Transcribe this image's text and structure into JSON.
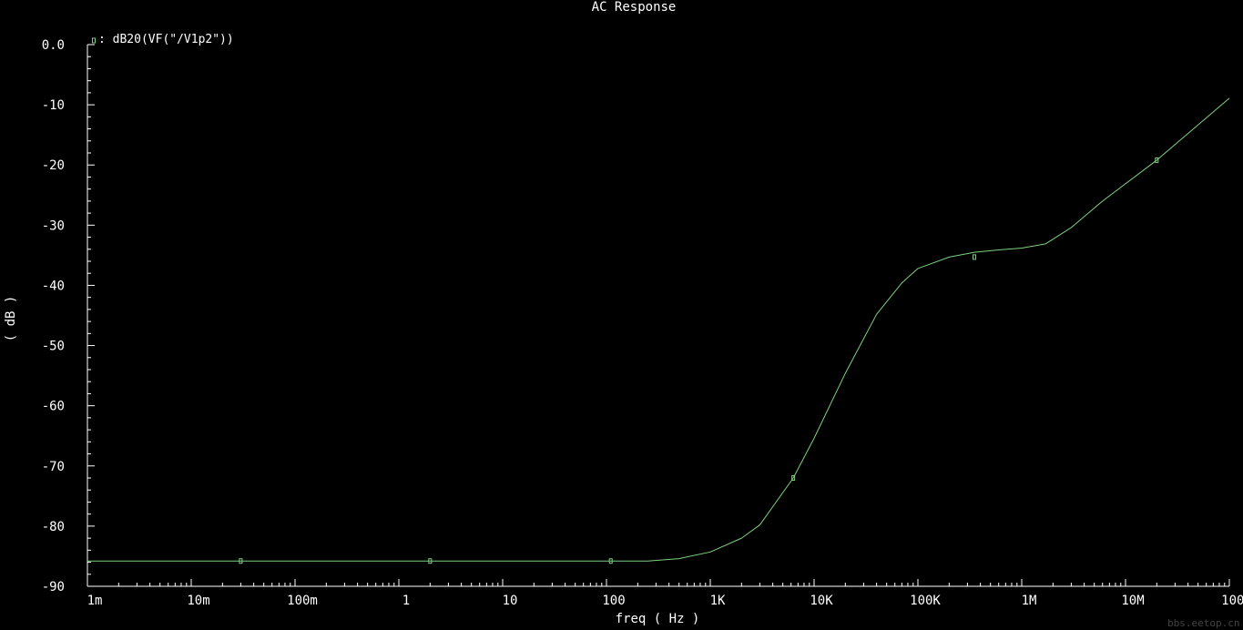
{
  "chart_data": {
    "type": "line",
    "title": "AC Response",
    "xlabel": "freq ( Hz )",
    "ylabel": "( dB )",
    "xscale": "log",
    "xlim": [
      0.001,
      100000000
    ],
    "ylim": [
      -90,
      0
    ],
    "xticks": [
      {
        "value": 0.001,
        "label": "1m"
      },
      {
        "value": 0.01,
        "label": "10m"
      },
      {
        "value": 0.1,
        "label": "100m"
      },
      {
        "value": 1,
        "label": "1"
      },
      {
        "value": 10,
        "label": "10"
      },
      {
        "value": 100,
        "label": "100"
      },
      {
        "value": 1000,
        "label": "1K"
      },
      {
        "value": 10000,
        "label": "10K"
      },
      {
        "value": 100000,
        "label": "100K"
      },
      {
        "value": 1000000,
        "label": "1M"
      },
      {
        "value": 10000000,
        "label": "10M"
      },
      {
        "value": 100000000,
        "label": "100M"
      }
    ],
    "yticks": [
      {
        "value": 0,
        "label": "0.0"
      },
      {
        "value": -10,
        "label": "-10"
      },
      {
        "value": -20,
        "label": "-20"
      },
      {
        "value": -30,
        "label": "-30"
      },
      {
        "value": -40,
        "label": "-40"
      },
      {
        "value": -50,
        "label": "-50"
      },
      {
        "value": -60,
        "label": "-60"
      },
      {
        "value": -70,
        "label": "-70"
      },
      {
        "value": -80,
        "label": "-80"
      },
      {
        "value": -90,
        "label": "-90"
      }
    ],
    "legend": "top-left",
    "grid": false,
    "background": "#000000",
    "axis_color": "#ffffff",
    "series": [
      {
        "name": ": dB20(VF(\"/V1p2\"))",
        "color": "#7fd07f",
        "x": [
          0.001,
          0.03,
          2,
          110,
          250,
          500,
          1000,
          2000,
          3000,
          6300,
          10000,
          20000,
          40000,
          70000,
          100000,
          200000,
          350000,
          600000,
          1000000,
          1700000,
          3000000,
          6000000,
          20000000,
          100000000
        ],
        "y": [
          -85.8,
          -85.8,
          -85.8,
          -85.8,
          -85.8,
          -85.4,
          -84.3,
          -82.0,
          -79.8,
          -72.0,
          -65.4,
          -54.6,
          -44.8,
          -39.6,
          -37.2,
          -35.3,
          -34.5,
          -34.1,
          -33.8,
          -33.1,
          -30.4,
          -26.0,
          -19.2,
          -8.9
        ],
        "markers_x": [
          0.03,
          2,
          110,
          6300,
          350000,
          20000000
        ],
        "markers_y": [
          -85.8,
          -85.8,
          -85.8,
          -72.0,
          -35.3,
          -19.2
        ]
      }
    ]
  },
  "watermark": "bbs.eetop.cn"
}
